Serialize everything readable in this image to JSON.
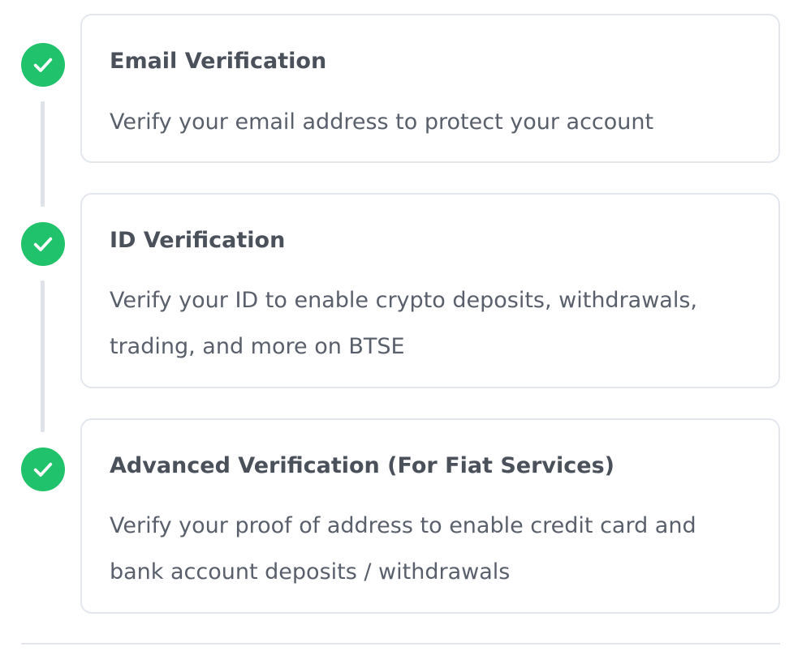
{
  "steps": [
    {
      "title": "Email Verification",
      "description": "Verify your email address to protect your account",
      "status": "completed",
      "icon": "check-icon"
    },
    {
      "title": "ID Verification",
      "description": "Verify your ID to enable crypto deposits, withdrawals, trading, and more on BTSE",
      "status": "completed",
      "icon": "check-icon"
    },
    {
      "title": "Advanced Verification (For Fiat Services)",
      "description": "Verify your proof of address to enable credit card and bank account deposits / withdrawals",
      "status": "completed",
      "icon": "check-icon"
    }
  ],
  "colors": {
    "success": "#20c36b",
    "card_border": "#e3e7ed",
    "title_text": "#4b515b",
    "body_text": "#5a606b",
    "timeline": "#dfe3e9"
  }
}
